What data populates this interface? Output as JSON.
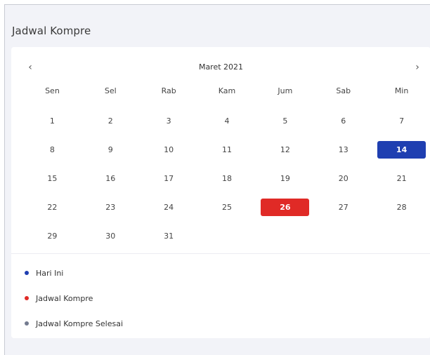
{
  "card": {
    "title": "Jadwal Kompre"
  },
  "calendar": {
    "month_label": "Maret 2021",
    "prev_icon": "‹",
    "next_icon": "›",
    "weekdays": [
      "Sen",
      "Sel",
      "Rab",
      "Kam",
      "Jum",
      "Sab",
      "Min"
    ],
    "weeks": [
      [
        {
          "d": "1"
        },
        {
          "d": "2"
        },
        {
          "d": "3"
        },
        {
          "d": "4"
        },
        {
          "d": "5"
        },
        {
          "d": "6"
        },
        {
          "d": "7"
        }
      ],
      [
        {
          "d": "8"
        },
        {
          "d": "9"
        },
        {
          "d": "10"
        },
        {
          "d": "11"
        },
        {
          "d": "12"
        },
        {
          "d": "13"
        },
        {
          "d": "14",
          "state": "today"
        }
      ],
      [
        {
          "d": "15"
        },
        {
          "d": "16"
        },
        {
          "d": "17"
        },
        {
          "d": "18"
        },
        {
          "d": "19"
        },
        {
          "d": "20"
        },
        {
          "d": "21"
        }
      ],
      [
        {
          "d": "22"
        },
        {
          "d": "23"
        },
        {
          "d": "24"
        },
        {
          "d": "25"
        },
        {
          "d": "26",
          "state": "kompre"
        },
        {
          "d": "27"
        },
        {
          "d": "28"
        }
      ],
      [
        {
          "d": "29"
        },
        {
          "d": "30"
        },
        {
          "d": "31"
        },
        {
          "d": ""
        },
        {
          "d": ""
        },
        {
          "d": ""
        },
        {
          "d": ""
        }
      ]
    ]
  },
  "legend": [
    {
      "label": "Hari Ini",
      "color": "#1f3fb1"
    },
    {
      "label": "Jadwal Kompre",
      "color": "#e02a26"
    },
    {
      "label": "Jadwal Kompre Selesai",
      "color": "#737b8f"
    }
  ]
}
